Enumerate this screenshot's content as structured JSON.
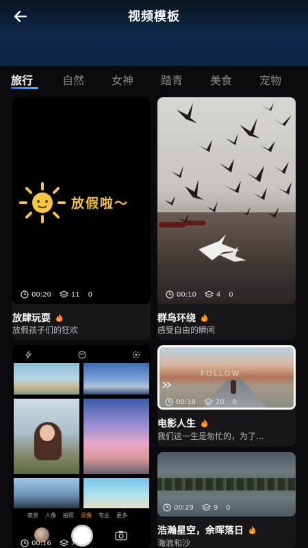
{
  "header": {
    "title": "视频模板",
    "back_icon": "back-arrow-icon"
  },
  "tabs": [
    {
      "label": "旅行",
      "active": true
    },
    {
      "label": "自然"
    },
    {
      "label": "女神"
    },
    {
      "label": "踏青"
    },
    {
      "label": "美食"
    },
    {
      "label": "宠物"
    }
  ],
  "cards": [
    {
      "duration": "00:20",
      "clips": "11",
      "extra": "0",
      "title": "放肆玩耍",
      "subtitle": "放假孩子们的狂欢",
      "art_text": "放假啦～"
    },
    {
      "duration": "00:10",
      "clips": "4",
      "extra": "0",
      "title": "群鸟环绕",
      "subtitle": "感受自由的瞬间"
    },
    {
      "duration": "00:16",
      "clips": "7",
      "title": "",
      "subtitle": "",
      "camera_modes": [
        "夜景",
        "人像",
        "拍照",
        "录像",
        "专业",
        "更多"
      ]
    },
    {
      "duration": "00:18",
      "clips": "20",
      "extra": "0",
      "title": "电影人生",
      "subtitle": "我们这一生是匆忙的，为了...",
      "overlay_text": "FOLLOW"
    },
    {
      "duration": "00:29",
      "clips": "9",
      "extra": "0",
      "title": "浩瀚星空，余晖落日",
      "subtitle": "海浪和沙"
    }
  ],
  "colors": {
    "accent": "#3b5bff",
    "flame": "#ff8a1c",
    "sun": "#f7c642"
  }
}
